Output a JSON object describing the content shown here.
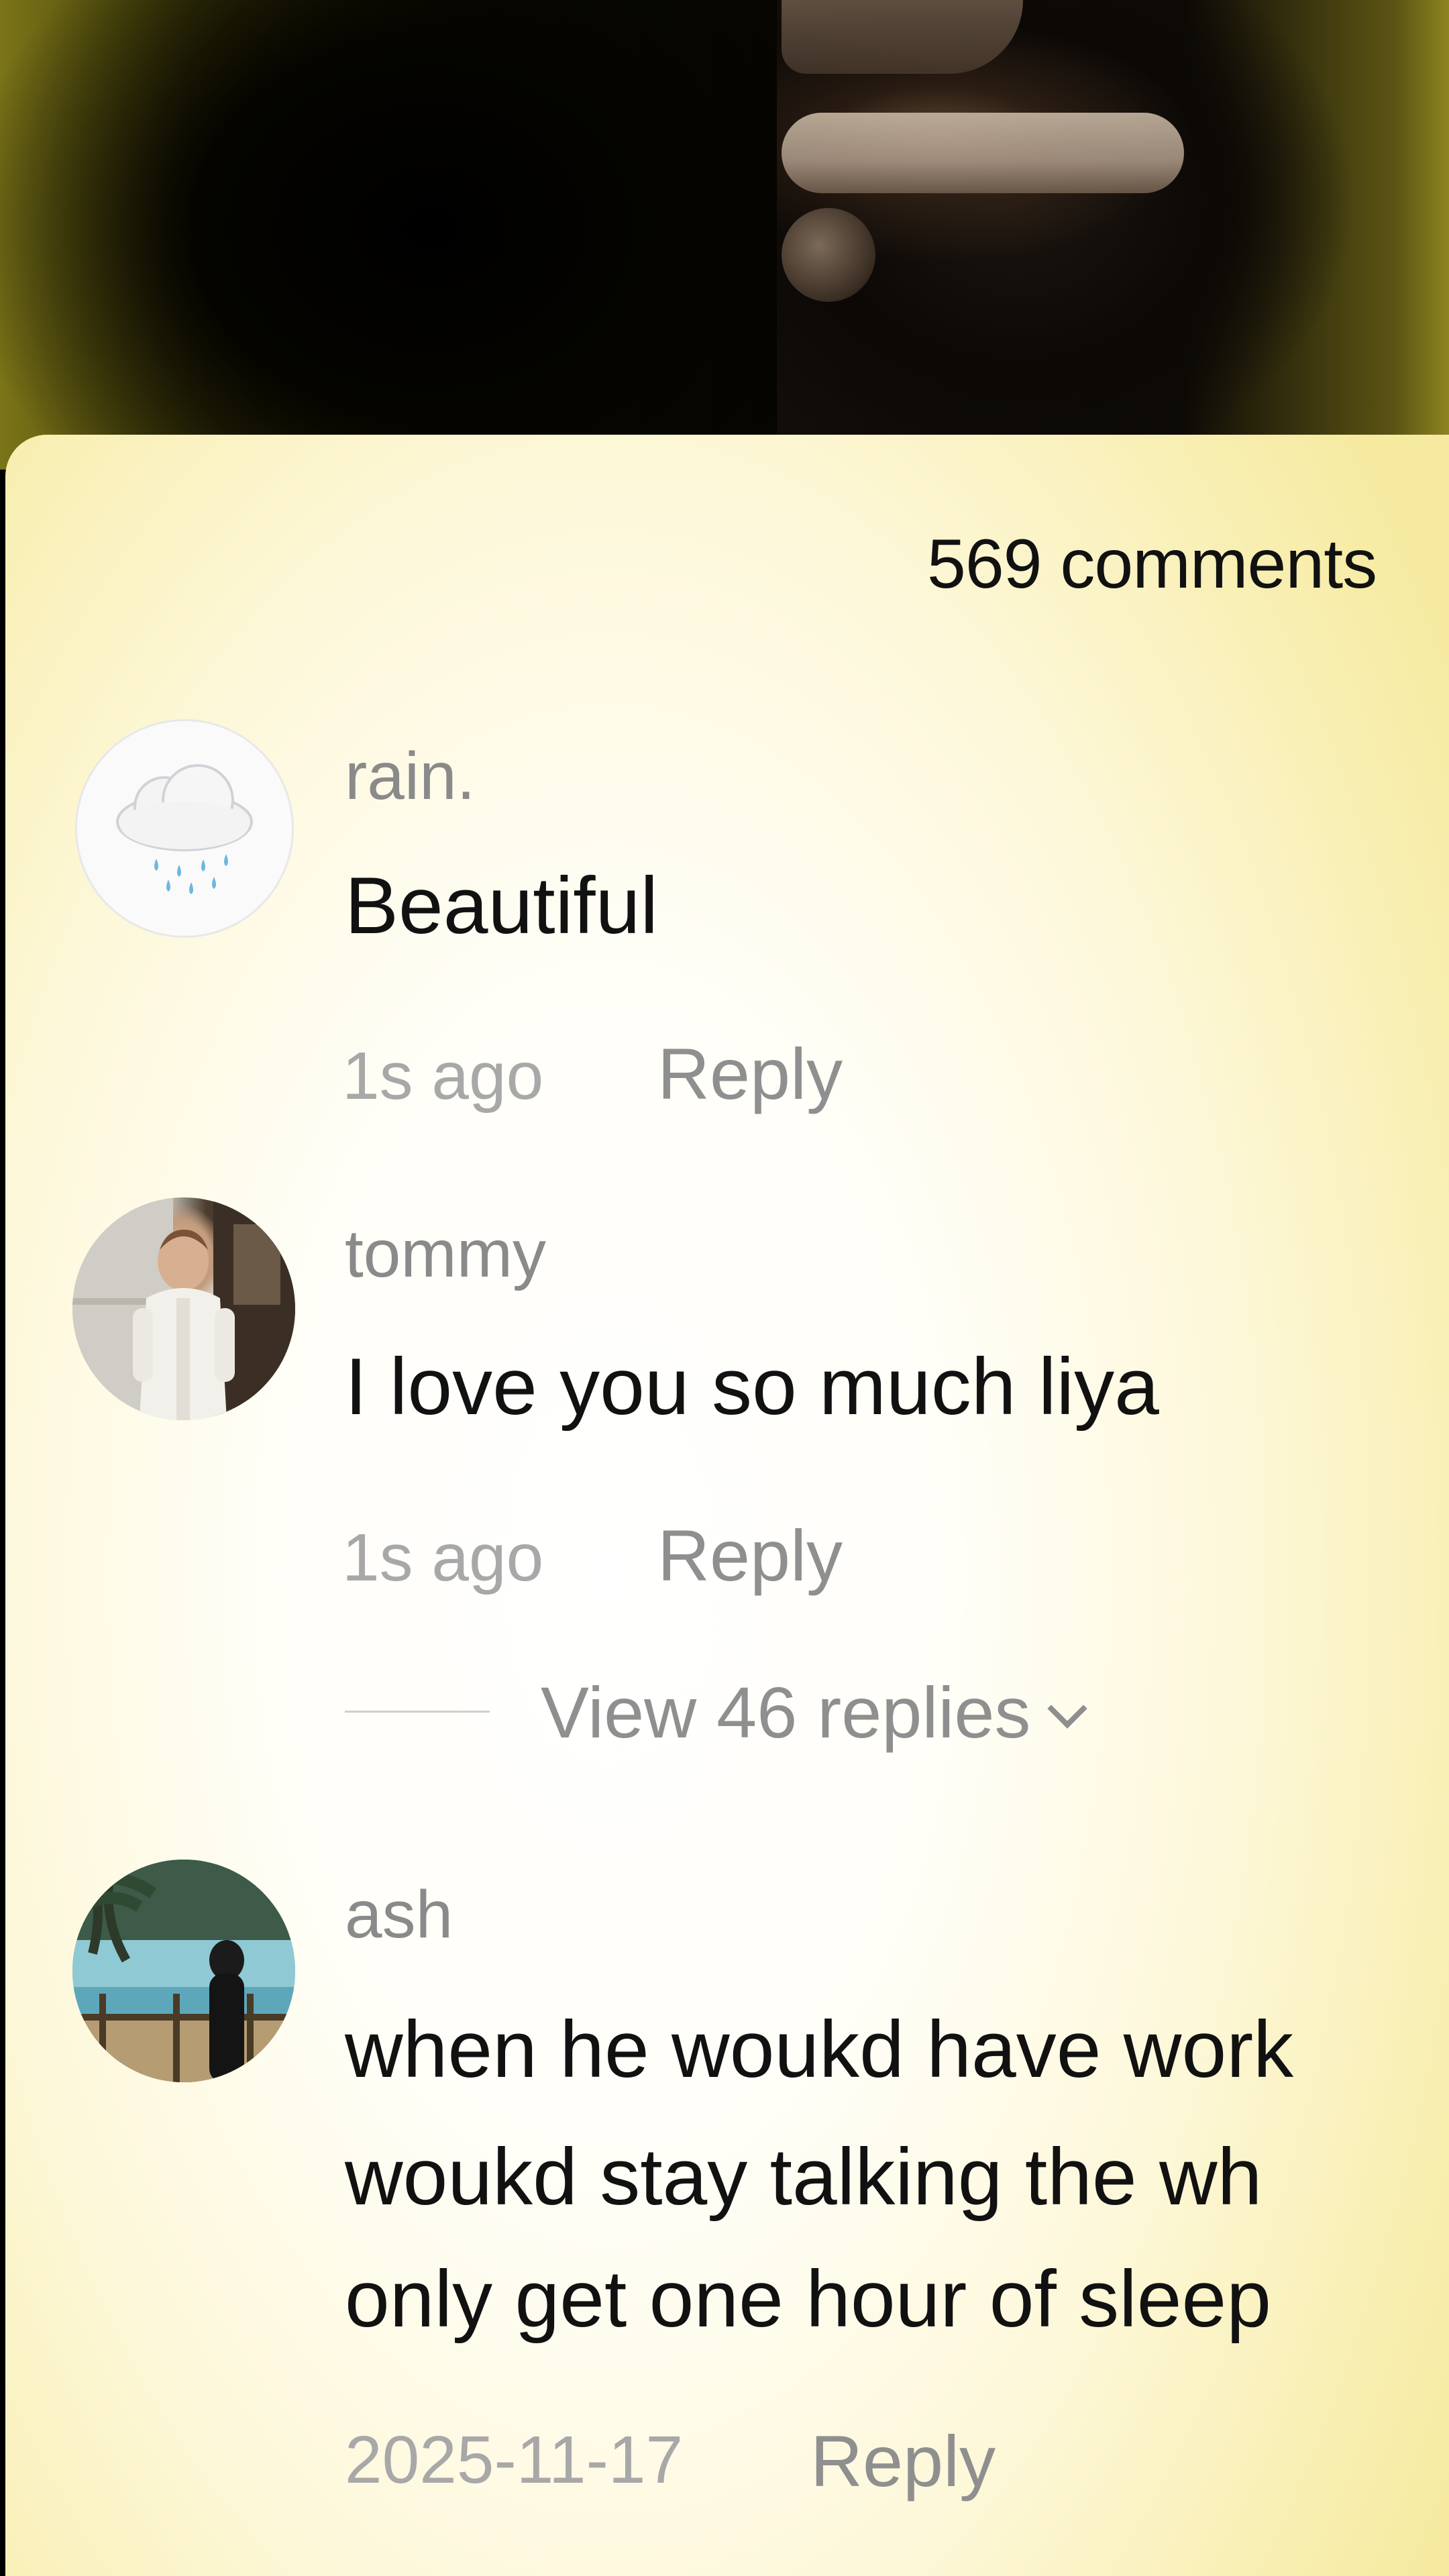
{
  "header": {
    "comment_count": "569 comments"
  },
  "comments": [
    {
      "username": "rain.",
      "text": "Beautiful",
      "time": "1s ago",
      "reply_label": "Reply",
      "avatar_icon": "rain-cloud-icon"
    },
    {
      "username": "tommy",
      "text": "I love you so much liya",
      "time": "1s ago",
      "reply_label": "Reply",
      "view_replies": "View 46 replies"
    },
    {
      "username": "ash",
      "text_lines": [
        "when he woukd have work",
        "woukd stay talking the wh",
        "only get one hour of sleep"
      ],
      "time": "2025-11-17",
      "reply_label": "Reply"
    }
  ],
  "colors": {
    "text_primary": "#111111",
    "text_secondary": "#8a8a8a",
    "sheet_bg_center": "#ffffff",
    "sheet_bg_edge": "#f6eaa0"
  }
}
